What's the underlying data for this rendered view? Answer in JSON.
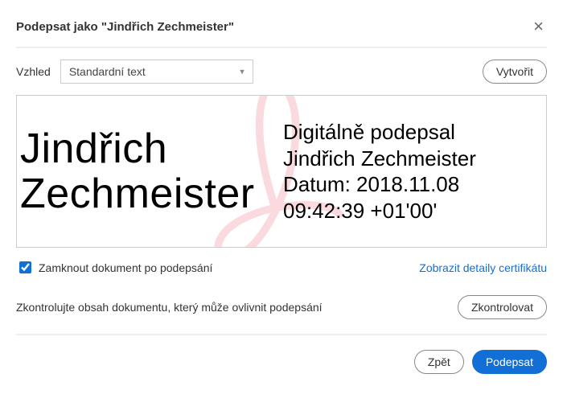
{
  "header": {
    "title": "Podepsat jako \"Jindřich Zechmeister\""
  },
  "appearance": {
    "label": "Vzhled",
    "selected": "Standardní text",
    "create_button": "Vytvořit"
  },
  "preview": {
    "name_line1": "Jindřich",
    "name_line2": "Zechmeister",
    "info_line1": "Digitálně podepsal",
    "info_line2": "Jindřich Zechmeister",
    "info_line3": "Datum: 2018.11.08",
    "info_line4": "09:42:39 +01'00'"
  },
  "lock_row": {
    "checked": true,
    "label": "Zamknout dokument po podepsání",
    "cert_link": "Zobrazit detaily certifikátu"
  },
  "review_row": {
    "text": "Zkontrolujte obsah dokumentu, který může ovlivnit podepsání",
    "button": "Zkontrolovat"
  },
  "footer": {
    "back": "Zpět",
    "sign": "Podepsat"
  }
}
